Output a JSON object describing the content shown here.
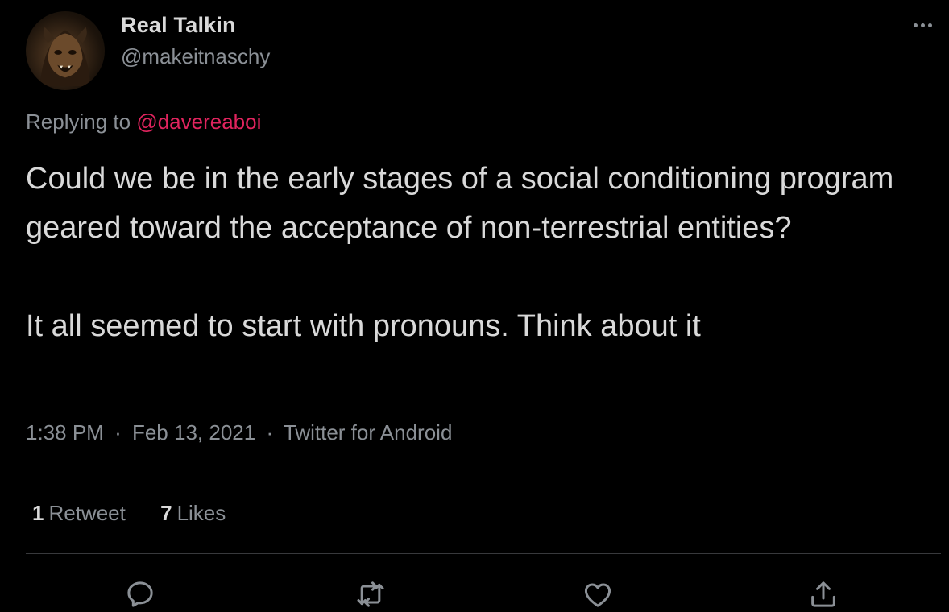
{
  "author": {
    "display_name": "Real Talkin",
    "handle": "@makeitnaschy"
  },
  "reply": {
    "prefix": "Replying to",
    "mention": "@davereaboi"
  },
  "tweet": {
    "line1": "Could we be in the early stages of a social conditioning program geared toward the acceptance of non-terrestrial entities?",
    "line2": "It all seemed to start with pronouns.  Think about it"
  },
  "meta": {
    "time": "1:38 PM",
    "separator": "·",
    "date": "Feb 13, 2021",
    "source": "Twitter for Android"
  },
  "stats": {
    "retweets_count": "1",
    "retweets_label": "Retweet",
    "likes_count": "7",
    "likes_label": "Likes"
  },
  "icons": {
    "more": "more-horizontal-icon",
    "reply": "reply-icon",
    "retweet": "retweet-icon",
    "like": "heart-icon",
    "share": "share-icon"
  },
  "colors": {
    "background": "#000000",
    "text": "#d9d9d9",
    "secondary": "#8b9096",
    "mention": "#e0245e",
    "divider": "#38393c"
  }
}
